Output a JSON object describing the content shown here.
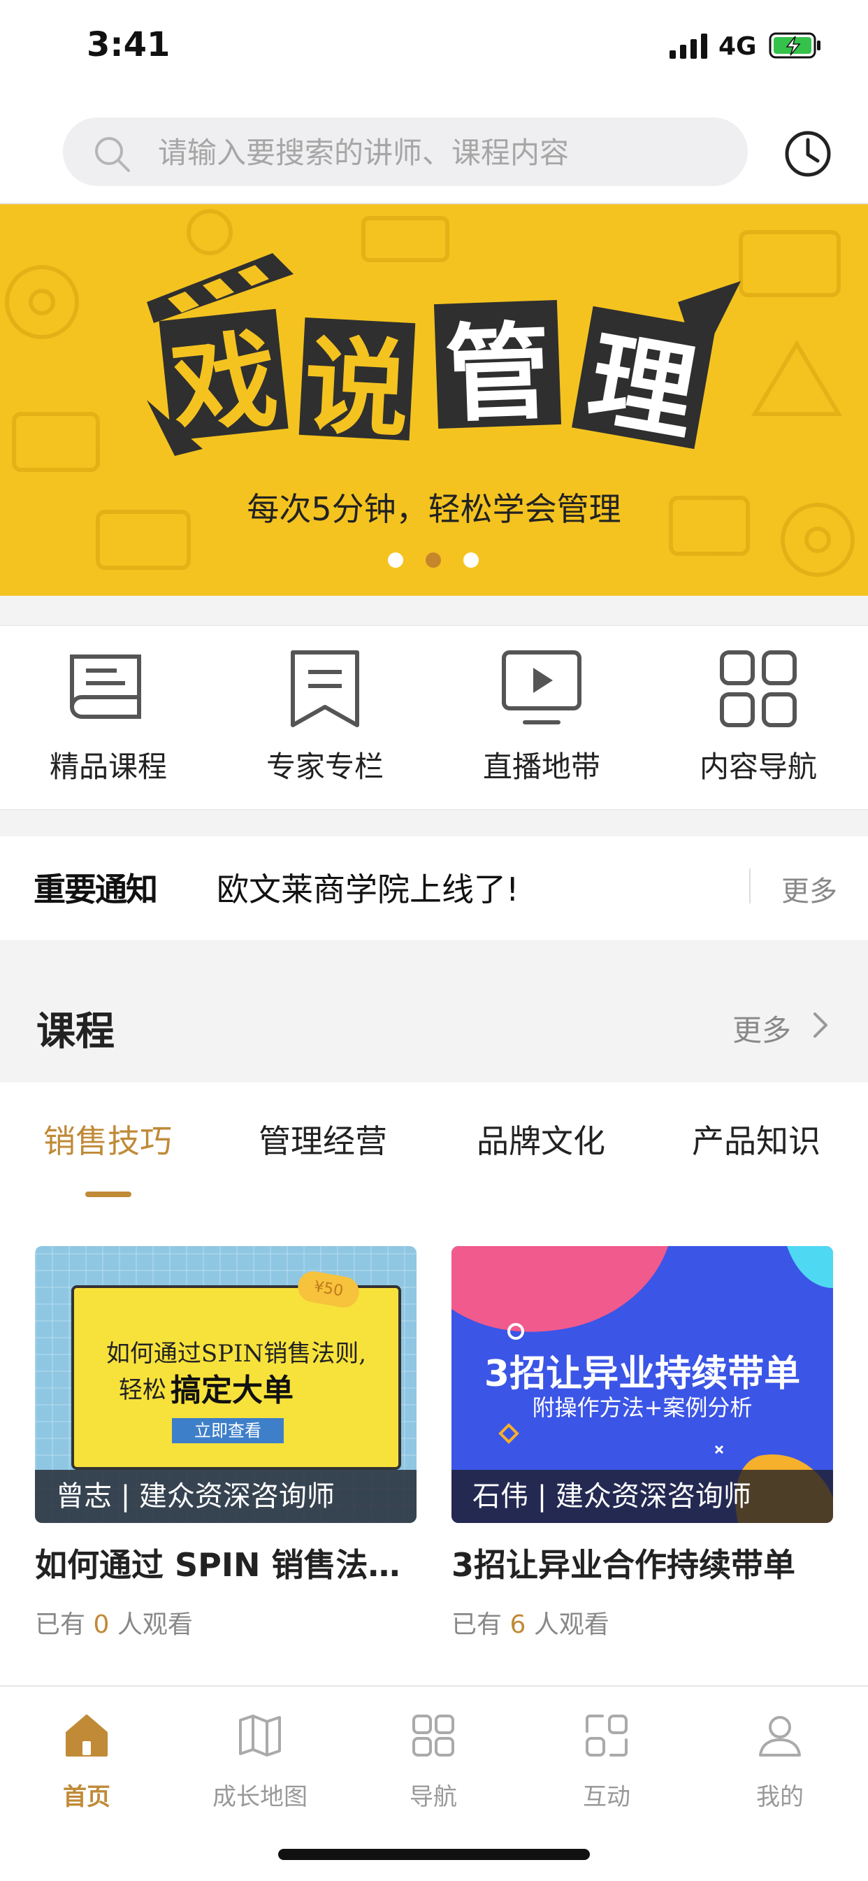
{
  "status_bar": {
    "time": "3:41",
    "network": "4G"
  },
  "search": {
    "placeholder": "请输入要搜索的讲师、课程内容"
  },
  "banner": {
    "title_chars": [
      "戏",
      "说",
      "管",
      "理"
    ],
    "subtitle": "每次5分钟，轻松学会管理",
    "dots_total": 3,
    "active_dot": 1
  },
  "quick_nav": [
    {
      "label": "精品课程",
      "icon": "book-icon"
    },
    {
      "label": "专家专栏",
      "icon": "bookmark-icon"
    },
    {
      "label": "直播地带",
      "icon": "tv-play-icon"
    },
    {
      "label": "内容导航",
      "icon": "grid-icon"
    }
  ],
  "notice": {
    "badge": "重要通知",
    "text": "欧文莱商学院上线了!",
    "more": "更多"
  },
  "courses": {
    "title": "课程",
    "more": "更多",
    "tabs": [
      "销售技巧",
      "管理经营",
      "品牌文化",
      "产品知识"
    ],
    "active_tab": 0,
    "items": [
      {
        "thumb_line1": "如何通过SPIN销售法则,",
        "thumb_line2_a": "轻松",
        "thumb_line2_b": "搞定大单",
        "thumb_button": "立即查看",
        "thumb_price": "¥50",
        "caption": "曾志 | 建众资深咨询师",
        "title": "如何通过 SPIN 销售法则，轻松搞定大单",
        "views_prefix": "已有",
        "views_count": "0",
        "views_suffix": "人观看"
      },
      {
        "thumb_line1": "3招让异业持续带单",
        "thumb_line2": "附操作方法+案例分析",
        "caption": "石伟 | 建众资深咨询师",
        "title": "3招让异业合作持续带单",
        "views_prefix": "已有",
        "views_count": "6",
        "views_suffix": "人观看"
      }
    ]
  },
  "tab_bar": [
    {
      "label": "首页",
      "icon": "home-icon",
      "active": true
    },
    {
      "label": "成长地图",
      "icon": "map-icon",
      "active": false
    },
    {
      "label": "导航",
      "icon": "grid-icon",
      "active": false
    },
    {
      "label": "互动",
      "icon": "interact-icon",
      "active": false
    },
    {
      "label": "我的",
      "icon": "user-icon",
      "active": false
    }
  ],
  "colors": {
    "accent": "#c08a37",
    "banner_yellow": "#f4c320",
    "tile_dark": "#2f2f2f",
    "card2_blue": "#3b55e6"
  }
}
